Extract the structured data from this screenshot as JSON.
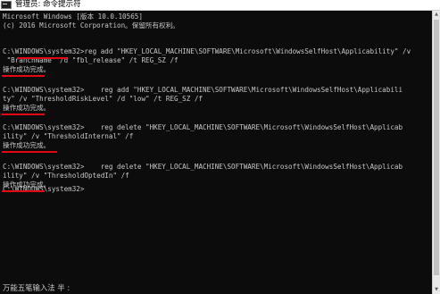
{
  "window": {
    "title": "管理员: 命令提示符",
    "colors": {
      "background": "#0c0c0c",
      "text": "#c8c8c8",
      "underline": "#e30613"
    }
  },
  "console": {
    "lines": [
      "Microsoft Windows [版本 10.0.10565]",
      "(c) 2016 Microsoft Corporation。保留所有权利。",
      "",
      "C:\\WINDOWS\\system32>reg add \"HKEY_LOCAL_MACHINE\\SOFTWARE\\Microsoft\\WindowsSelfHost\\Applicability\" /v",
      " \"BranchName\" /d \"fbl_release\" /t REG_SZ /f",
      "操作成功完成。",
      "",
      "C:\\WINDOWS\\system32>    reg add \"HKEY_LOCAL_MACHINE\\SOFTWARE\\Microsoft\\WindowsSelfHost\\Applicabili",
      "ty\" /v \"ThresholdRiskLevel\" /d \"low\" /t REG_SZ /f",
      "操作成功完成。",
      "",
      "C:\\WINDOWS\\system32>    reg delete \"HKEY_LOCAL_MACHINE\\SOFTWARE\\Microsoft\\WindowsSelfHost\\Applicab",
      "ility\" /v \"ThresholdInternal\" /f",
      "操作成功完成。",
      "",
      "C:\\WINDOWS\\system32>    reg delete \"HKEY_LOCAL_MACHINE\\SOFTWARE\\Microsoft\\WindowsSelfHost\\Applicab",
      "ility\" /v \"ThresholdOptedIn\" /f",
      "操作成功完成。",
      "",
      "C:\\WINDOWS\\system32>"
    ]
  },
  "ime": {
    "status": "万能五笔输入法 半 :"
  }
}
